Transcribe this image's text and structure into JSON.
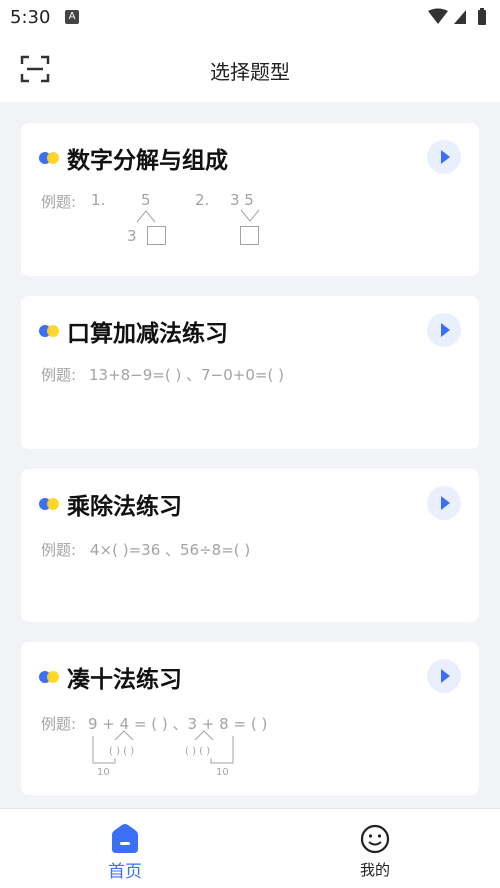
{
  "status_bar": {
    "time": "5:30",
    "notification_icon": "a-icon"
  },
  "header": {
    "title": "选择题型",
    "scan_icon": "scan-icon"
  },
  "cards": [
    {
      "title": "数字分解与组成",
      "example_label": "例题:",
      "example": "1.",
      "example_part2": "2.",
      "diagram1_top": "5",
      "diagram1_left": "3",
      "diagram2_top": "3 5"
    },
    {
      "title": "口算加减法练习",
      "example_label": "例题:",
      "example": "13+8−9=(    ) 、7−0+0=(   )"
    },
    {
      "title": "乘除法练习",
      "example_label": "例题:",
      "example": "4×(     )=36 、56÷8=(    )"
    },
    {
      "title": "凑十法练习",
      "example_label": "例题:",
      "example": "9 + 4 = (   ) 、3 + 8 = (   )",
      "sub_left": "( ) ( )",
      "sub_right": "( ) ( )",
      "ten_left": "10",
      "ten_right": "10"
    }
  ],
  "tabs": [
    {
      "label": "首页",
      "icon": "home-icon",
      "active": true
    },
    {
      "label": "我的",
      "icon": "smile-icon",
      "active": false
    }
  ],
  "colors": {
    "accent": "#3b6ff5",
    "yellow": "#ffd51f",
    "play_bg": "#eaf0fb"
  }
}
